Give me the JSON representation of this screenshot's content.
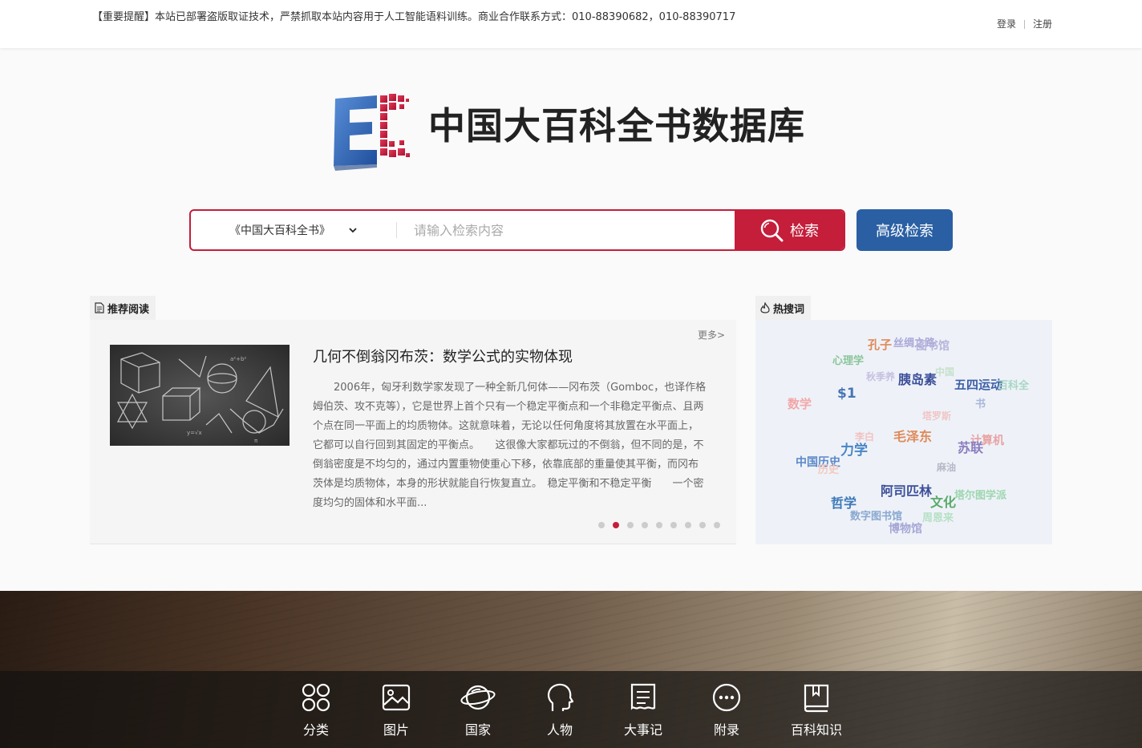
{
  "topbar": {
    "notice": "【重要提醒】本站已部署盗版取证技术，严禁抓取本站内容用于人工智能语料训练。商业合作联系方式：010-88390682，010-88390717",
    "login": "登录",
    "register": "注册"
  },
  "brand": {
    "title": "中国大百科全书数据库",
    "colors": {
      "red": "#c41e3a",
      "blue": "#2a5fa3"
    }
  },
  "search": {
    "scope": "《中国大百科全书》",
    "placeholder": "请输入检索内容",
    "value": "",
    "submit_label": "检索",
    "advanced_label": "高级检索"
  },
  "recommend": {
    "tab_label": "推荐阅读",
    "more": "更多>",
    "title": "几何不倒翁冈布茨：数学公式的实物体现",
    "body": "2006年，匈牙利数学家发现了一种全新几何体——冈布茨（Gomboc，也译作格姆伯茨、攻不克等），它是世界上首个只有一个稳定平衡点和一个非稳定平衡点、且两个点在同一平面上的均质物体。这就意味着，无论以任何角度将其放置在水平面上，它都可以自行回到其固定的平衡点。　　这很像大家都玩过的不倒翁，但不同的是，不倒翁密度是不均匀的，通过内置重物使重心下移，依靠底部的重量使其平衡，而冈布茨体是均质物体，本身的形状就能自行恢复直立。　稳定平衡和不稳定平衡　　一个密度均匀的固体和水平面...",
    "slide_count": 9,
    "active_slide": 1
  },
  "hot": {
    "tab_label": "热搜词",
    "words": [
      {
        "text": "孔子",
        "color": "#e08a5a",
        "size": 15
      },
      {
        "text": "丝绸之路",
        "color": "#a9a6d8",
        "size": 13
      },
      {
        "text": "图书馆",
        "color": "#b7b5dc",
        "size": 14
      },
      {
        "text": "心理学",
        "color": "#8bc59a",
        "size": 13
      },
      {
        "text": "中国",
        "color": "#c7e0cd",
        "size": 12
      },
      {
        "text": "秋季养",
        "color": "#c6c0e0",
        "size": 12
      },
      {
        "text": "胰岛素",
        "color": "#3c4f9a",
        "size": 16
      },
      {
        "text": "五四运动",
        "color": "#3d5fa8",
        "size": 15
      },
      {
        "text": "百科全",
        "color": "#a8d6c4",
        "size": 13
      },
      {
        "text": "书",
        "color": "#a8b8d8",
        "size": 13
      },
      {
        "text": "$1",
        "color": "#4a74b8",
        "size": 17
      },
      {
        "text": "数学",
        "color": "#f3a7a8",
        "size": 15
      },
      {
        "text": "塔罗斯",
        "color": "#f0c6c6",
        "size": 12
      },
      {
        "text": "毛泽东",
        "color": "#e08a5a",
        "size": 16
      },
      {
        "text": "计算机",
        "color": "#e8a2a2",
        "size": 14
      },
      {
        "text": "李白",
        "color": "#f2c2c2",
        "size": 12
      },
      {
        "text": "力学",
        "color": "#4a86c6",
        "size": 17
      },
      {
        "text": "苏联",
        "color": "#8a7ec0",
        "size": 16
      },
      {
        "text": "中国历史",
        "color": "#5a88c8",
        "size": 14
      },
      {
        "text": "历史",
        "color": "#f3c9c0",
        "size": 13
      },
      {
        "text": "麻油",
        "color": "#b8b8c8",
        "size": 12
      },
      {
        "text": "阿司匹林",
        "color": "#3c4f9a",
        "size": 16
      },
      {
        "text": "哲学",
        "color": "#3c78b8",
        "size": 16
      },
      {
        "text": "文化",
        "color": "#5aaa6a",
        "size": 16
      },
      {
        "text": "塔尔图学派",
        "color": "#9ed6b0",
        "size": 13
      },
      {
        "text": "数字图书馆",
        "color": "#8aa8d0",
        "size": 13
      },
      {
        "text": "周恩来",
        "color": "#b6e0c6",
        "size": 13
      },
      {
        "text": "博物馆",
        "color": "#a6a6d6",
        "size": 14
      }
    ]
  },
  "nav": [
    {
      "label": "分类",
      "icon": "grid-clover-icon"
    },
    {
      "label": "图片",
      "icon": "image-icon"
    },
    {
      "label": "国家",
      "icon": "planet-icon"
    },
    {
      "label": "人物",
      "icon": "head-profile-icon"
    },
    {
      "label": "大事记",
      "icon": "document-icon"
    },
    {
      "label": "附录",
      "icon": "more-circle-icon"
    },
    {
      "label": "百科知识",
      "icon": "book-icon"
    }
  ]
}
